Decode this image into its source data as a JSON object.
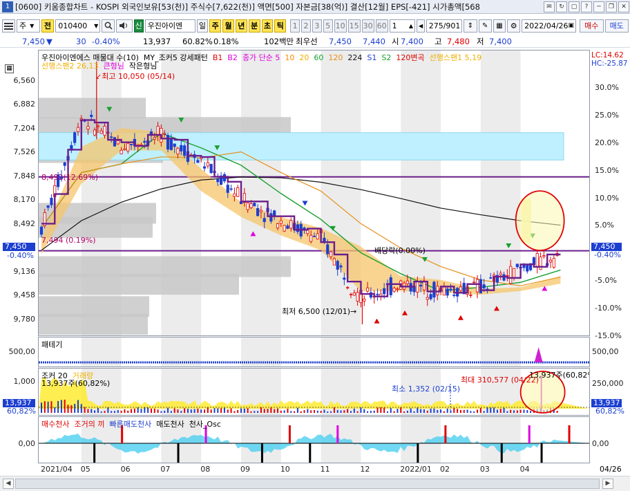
{
  "window": {
    "num": "1",
    "title": "[0600] 키움종합차트 - KOSPI 외국인보유[53(천)] 주식수[7,622(천)] 액면[500] 자본금[38(억)] 결산[12월] EPS[-421] 시가총액[568",
    "buttons": [
      "✉",
      "↻",
      "▢",
      "?",
      "─",
      "❐",
      "✕"
    ]
  },
  "toolbar": {
    "period_select": "주",
    "all_button": "전",
    "code_value": "010400",
    "stock_name": "우진아이엔",
    "tag_button": "신",
    "interval_buttons": [
      "일",
      "주",
      "월",
      "년",
      "분",
      "초",
      "틱"
    ],
    "minute_buttons": [
      "1",
      "2",
      "3",
      "5",
      "10",
      "15",
      "30",
      "60"
    ],
    "count_value": "1",
    "page_value": "275/901",
    "date_value": "2022/04/26",
    "buy_button": "매수",
    "sell_button": "매도"
  },
  "quote": {
    "price": "7,450",
    "price_arrow": "▼",
    "change": "30",
    "change_pct": "-0.40%",
    "volume": "13,937",
    "vol_ratio": "60.82%",
    "turnover": "0.18%",
    "unit_label": "102백만",
    "best_label": "최우선",
    "best_ask": "7,450",
    "best_bid": "7,440",
    "open_label": "시",
    "open_value": "7,400",
    "high_label": "고",
    "high_value": "7,480",
    "low_label": "저",
    "low_value": "7,400"
  },
  "colors": {
    "up": "#e00000",
    "down": "#1c3fd0",
    "price_line": "#6b1e8c",
    "ma5": "#e000e0",
    "ma10": "#ff8a00",
    "ma20": "#f0b000",
    "ma60": "#18a030",
    "ma120": "#e5901a",
    "ma224": "#111111",
    "box": "#c8c8c8",
    "band": "#bff0ff"
  },
  "price_panel": {
    "legend_line1": [
      {
        "text": "우진아이엔에스 매물대 수(10)",
        "color": "#000000"
      },
      {
        "text": "MY_조커5 강세패턴",
        "color": "#000000"
      },
      {
        "text": "B1",
        "color": "#e00000"
      },
      {
        "text": "B2",
        "color": "#e000e0"
      },
      {
        "text": "종가 단순 5",
        "color": "#e000e0"
      },
      {
        "text": "10",
        "color": "#ff8a00"
      },
      {
        "text": "20",
        "color": "#f0b000"
      },
      {
        "text": "60",
        "color": "#18a030"
      },
      {
        "text": "120",
        "color": "#e5901a"
      },
      {
        "text": "224",
        "color": "#111111"
      },
      {
        "text": "S1",
        "color": "#1c3fd0"
      },
      {
        "text": "S2",
        "color": "#18a030"
      },
      {
        "text": "120변곡",
        "color": "#e00000"
      },
      {
        "text": "선행스팬1 5,19",
        "color": "#f0b000"
      }
    ],
    "legend_line2": [
      {
        "text": "선행스팬2 26,13",
        "color": "#f0b000"
      },
      {
        "text": "큰형님",
        "color": "#e000e0"
      },
      {
        "text": "작은형님",
        "color": "#000000"
      }
    ],
    "y_ticks": [
      "9,780",
      "9,458",
      "9,136",
      "8,814",
      "8,492",
      "8,170",
      "7,848",
      "7,526",
      "7,204",
      "6,882",
      "6,560"
    ],
    "pct_ticks": [
      "30.0%",
      "25.0%",
      "20.0%",
      "15.0%",
      "10.0%",
      "5.0%",
      "-5.0%",
      "-10.0%",
      "-15.0%"
    ],
    "lc_label": "LC:14.62",
    "hc_label": "HC:-25.87",
    "price_tag": "7,450",
    "price_tag_pct": "-0.40%",
    "ann_high": "최고 10,050 (05/14)",
    "ann_low": "최저 6,500 (12/01)",
    "ann_8492": "8,492(12.69%)",
    "ann_7494": "7,494 (0.19%)",
    "ann_div": "배당락(0.00%)"
  },
  "pattern_panel": {
    "title": "패테기",
    "y_left": "500,00",
    "y_right": "500,00"
  },
  "volume_panel": {
    "legend": [
      {
        "text": "조커 20",
        "color": "#000000"
      },
      {
        "text": "거래량",
        "color": "#f0b000"
      }
    ],
    "y_left": "1,000",
    "y_right": "250,000",
    "sub_left": "13,937주(60,82%)",
    "ann_min": "최소 1,352 (02/15)",
    "ann_max": "최대 310,577 (04/22)",
    "ann_last": "13,937주(60,82%)",
    "tag_left": "13,937",
    "tag_left_pct": "60,82%",
    "tag_right": "13,937",
    "tag_right_pct": "60,82%"
  },
  "osc_panel": {
    "legend": [
      {
        "text": "매수천사",
        "color": "#e00000"
      },
      {
        "text": "조거의 끼",
        "color": "#e00000"
      },
      {
        "text": "빠른매도천사",
        "color": "#1c3fd0"
      },
      {
        "text": "매도천사",
        "color": "#000000"
      },
      {
        "text": "천사_Osc",
        "color": "#000000"
      }
    ],
    "y_left": "0,00",
    "y_right": "0,00"
  },
  "x_axis": {
    "labels": [
      "2021/04",
      "05",
      "06",
      "07",
      "08",
      "09",
      "10",
      "11",
      "12",
      "2022/01",
      "02",
      "03",
      "04"
    ],
    "right_label": "04/26"
  },
  "chart_data": {
    "type": "candlestick",
    "title": "우진아이엔에스",
    "x": [
      "2021/04",
      "05",
      "06",
      "07",
      "08",
      "09",
      "10",
      "11",
      "12",
      "2022/01",
      "02",
      "03",
      "04",
      "04/26"
    ],
    "close": [
      7800,
      9300,
      8900,
      9050,
      8700,
      8200,
      7900,
      7650,
      6850,
      7050,
      6950,
      7000,
      7250,
      7450
    ],
    "ma224": [
      7500,
      7900,
      8150,
      8330,
      8450,
      8490,
      8480,
      8420,
      8320,
      8200,
      8070,
      7980,
      7900,
      7840
    ],
    "ylim": [
      6350,
      10200
    ],
    "y_ticks": [
      6560,
      6882,
      7204,
      7526,
      7848,
      8170,
      8492,
      8814,
      9136,
      9458,
      9780
    ],
    "horizontal_lines": [
      8492,
      7494
    ],
    "high": {
      "value": 10050,
      "date": "05/14"
    },
    "low": {
      "value": 6500,
      "date": "12/01"
    },
    "last": {
      "price": 7450,
      "change_pct": -0.4
    },
    "volume_min": {
      "value": 1352,
      "date": "02/15"
    },
    "volume_max": {
      "value": 310577,
      "date": "04/22"
    },
    "volume_last": 13937
  }
}
